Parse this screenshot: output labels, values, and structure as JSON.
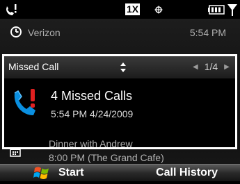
{
  "status_bar": {
    "network_type": "1X",
    "icons": [
      "missed-call-indicator-icon",
      "roaming-icon",
      "battery-icon",
      "signal-icon"
    ]
  },
  "home": {
    "carrier": "Verizon",
    "time": "5:54 PM",
    "notification": {
      "title": "Missed Call",
      "pager": "1/4",
      "headline": "4 Missed Calls",
      "timestamp": "5:54 PM 4/24/2009"
    },
    "appointment": {
      "title": "Dinner with Andrew",
      "detail": "8:00 PM (The Grand Cafe)"
    }
  },
  "softkeys": {
    "left": "Start",
    "right": "Call History"
  },
  "colors": {
    "background": "#000000",
    "missed_call_blue": "#0a8fe0",
    "missed_call_red": "#e02020"
  }
}
